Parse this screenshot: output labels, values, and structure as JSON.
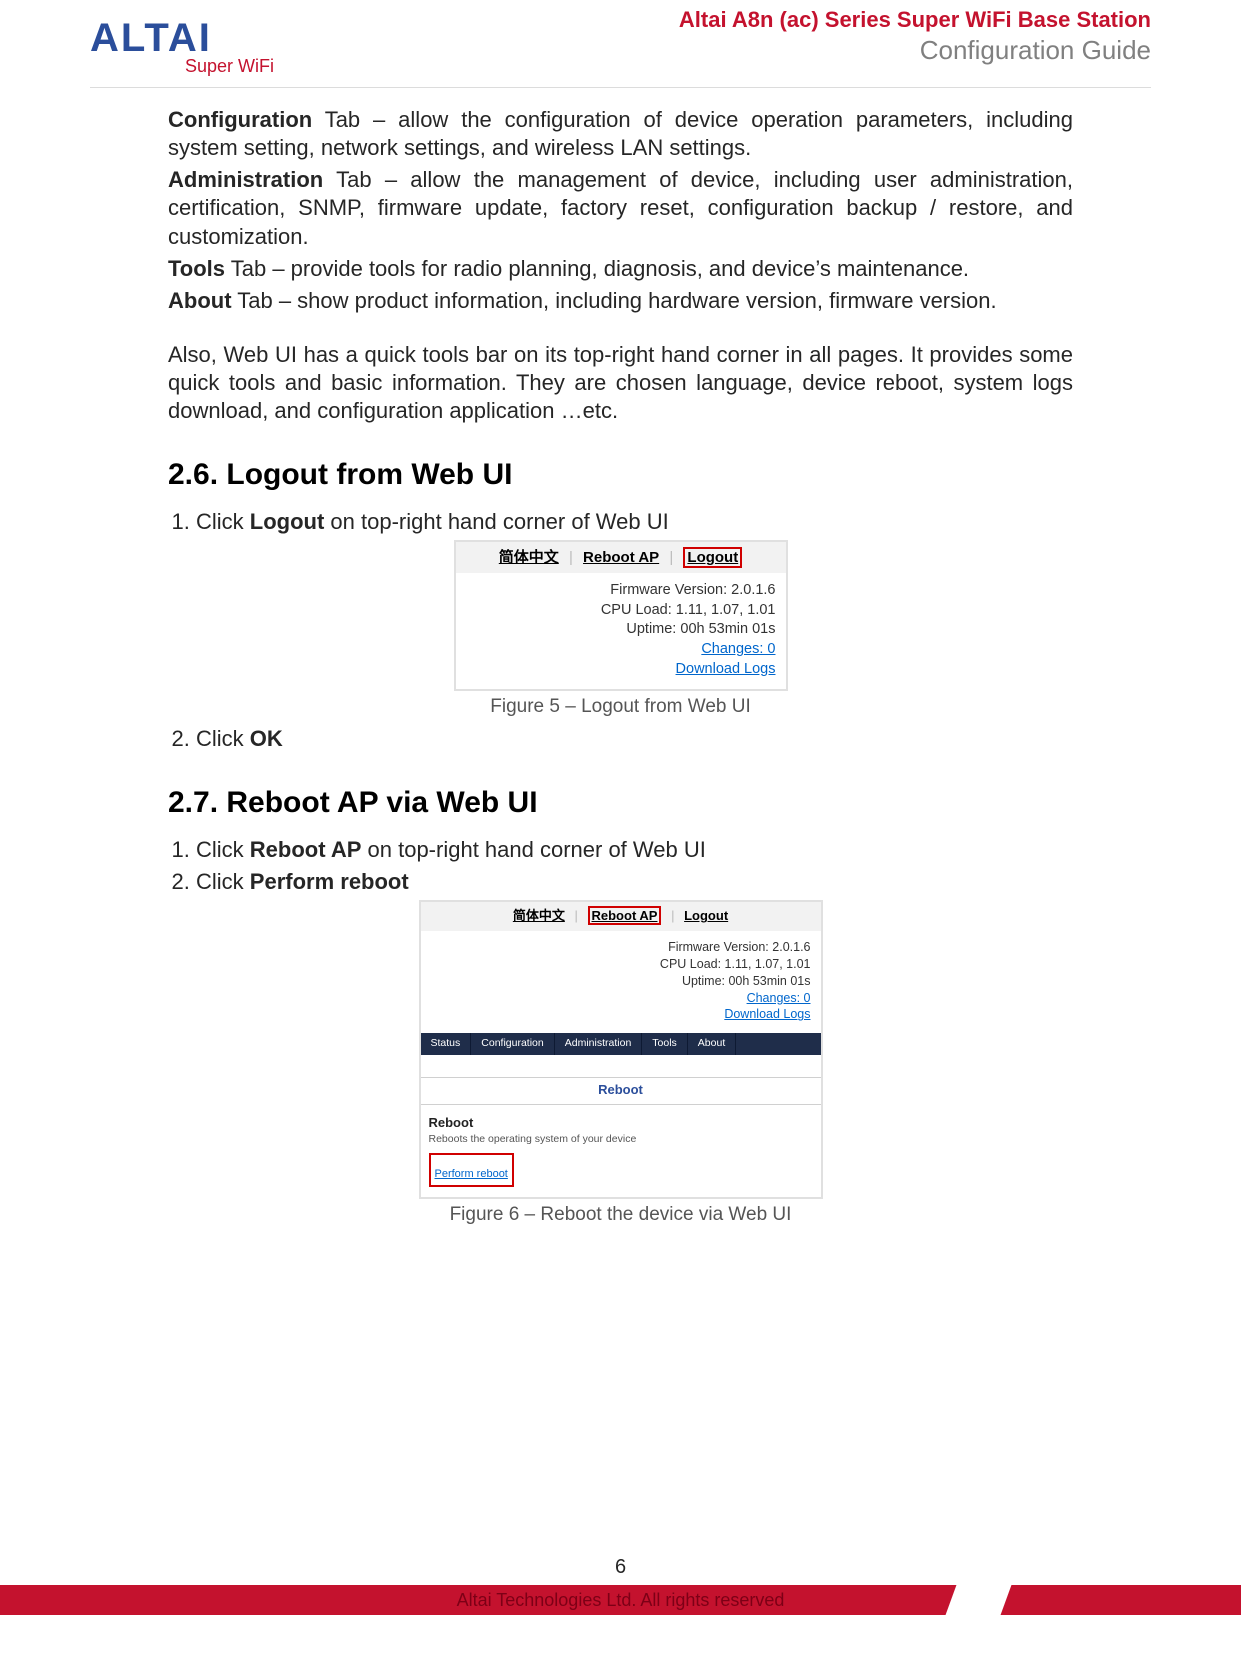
{
  "header": {
    "brand": "ALTAI",
    "brand_sub": "Super WiFi",
    "doc_line1": "Altai A8n (ac) Series Super WiFi Base Station",
    "doc_line2": "Configuration Guide"
  },
  "intro": {
    "config_b": "Configuration",
    "config_txt": " Tab – allow the configuration of device operation parameters, including system setting, network settings, and wireless LAN settings.",
    "admin_b": "Administration",
    "admin_txt": " Tab – allow the management of device, including user administration, certification, SNMP, firmware update, factory reset, configuration backup / restore, and customization.",
    "tools_b": "Tools",
    "tools_txt": " Tab – provide tools for radio planning, diagnosis, and device’s maintenance.",
    "about_b": "About",
    "about_txt": " Tab – show product information, including hardware version, firmware version.",
    "also": "Also, Web UI has a quick tools bar on its top-right hand corner in all pages. It provides some quick tools and basic information. They are chosen language, device reboot, system logs download, and configuration application …etc."
  },
  "s26": {
    "heading": "2.6.  Logout from Web UI",
    "step1_pre": "Click ",
    "step1_b": "Logout",
    "step1_post": " on top-right hand corner of Web UI",
    "step2_pre": "Click ",
    "step2_b": "OK"
  },
  "fig5": {
    "caption": "Figure 5 – Logout from Web UI",
    "lang": "简体中文",
    "reboot": "Reboot AP",
    "logout": "Logout",
    "fw_lbl": "Firmware Version: ",
    "fw": "2.0.1.6",
    "cpu_lbl": "CPU Load: ",
    "cpu": "1.11, 1.07, 1.01",
    "up_lbl": "Uptime: ",
    "up": "00h 53min 01s",
    "changes": "Changes: 0",
    "dl": "Download Logs"
  },
  "s27": {
    "heading": "2.7.  Reboot AP via Web UI",
    "step1_pre": "Click ",
    "step1_b": "Reboot AP",
    "step1_post": " on top-right hand corner of Web UI",
    "step2_pre": "Click ",
    "step2_b": "Perform reboot"
  },
  "fig6": {
    "caption": "Figure 6 – Reboot the device via Web UI",
    "lang": "简体中文",
    "reboot": "Reboot AP",
    "logout": "Logout",
    "fw_lbl": "Firmware Version: ",
    "fw": "2.0.1.6",
    "cpu_lbl": "CPU Load: ",
    "cpu": "1.11, 1.07, 1.01",
    "up_lbl": "Uptime: ",
    "up": "00h 53min 01s",
    "changes": "Changes: 0",
    "dl": "Download Logs",
    "tabs": [
      "Status",
      "Configuration",
      "Administration",
      "Tools",
      "About"
    ],
    "section": "Reboot",
    "panel_h": "Reboot",
    "panel_d": "Reboots the operating system of your device",
    "perform": "Perform reboot"
  },
  "footer": {
    "page": "6",
    "copyright": "Altai Technologies Ltd. All rights reserved"
  }
}
